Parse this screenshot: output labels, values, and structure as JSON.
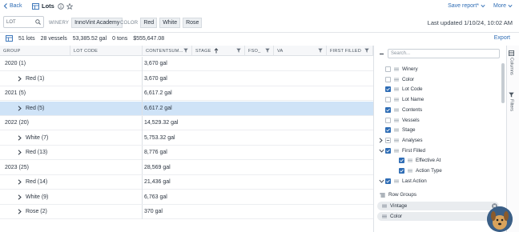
{
  "topbar": {
    "back_label": "Back",
    "title": "Lots",
    "save_report_label": "Save report*",
    "more_label": "More"
  },
  "filters": {
    "search_placeholder": "LOT",
    "winery_label": "WINERY",
    "winery_value": "InnoVint Academy",
    "color_label": "COLOR",
    "color_values": [
      "Red",
      "White",
      "Rose"
    ],
    "last_updated": "Last updated 1/10/24, 10:02 AM"
  },
  "summary": {
    "lots": "51 lots",
    "vessels": "28 vessels",
    "gallons": "53,385.52 gal",
    "tons": "0 tons",
    "value": "$555,647.08",
    "export_label": "Export"
  },
  "grid": {
    "headers": {
      "group": "GROUP",
      "lot_code": "LOT CODE",
      "contents": "CONTENTSUM...",
      "stage": "STAGE",
      "fso": "FSO_",
      "va": "VA",
      "first_filled": "FIRST FILLED"
    },
    "rows": [
      {
        "label": "2020 (1)",
        "contents": "3,670 gal",
        "level": 0,
        "expanded": true,
        "selected": false
      },
      {
        "label": "Red (1)",
        "contents": "3,670 gal",
        "level": 1,
        "expanded": false,
        "selected": false
      },
      {
        "label": "2021 (5)",
        "contents": "6,617.2 gal",
        "level": 0,
        "expanded": true,
        "selected": false
      },
      {
        "label": "Red (5)",
        "contents": "6,617.2 gal",
        "level": 1,
        "expanded": false,
        "selected": true
      },
      {
        "label": "2022 (20)",
        "contents": "14,529.32 gal",
        "level": 0,
        "expanded": true,
        "selected": false
      },
      {
        "label": "White (7)",
        "contents": "5,753.32 gal",
        "level": 1,
        "expanded": false,
        "selected": false
      },
      {
        "label": "Red (13)",
        "contents": "8,776 gal",
        "level": 1,
        "expanded": false,
        "selected": false
      },
      {
        "label": "2023 (25)",
        "contents": "28,569 gal",
        "level": 0,
        "expanded": true,
        "selected": false
      },
      {
        "label": "Red (14)",
        "contents": "21,436 gal",
        "level": 1,
        "expanded": false,
        "selected": false
      },
      {
        "label": "White (9)",
        "contents": "6,763 gal",
        "level": 1,
        "expanded": false,
        "selected": false
      },
      {
        "label": "Rose (2)",
        "contents": "370 gal",
        "level": 1,
        "expanded": false,
        "selected": false
      }
    ]
  },
  "panel": {
    "search_placeholder": "Search...",
    "columns": [
      {
        "label": "Winery",
        "checked": false,
        "indent": 0,
        "expander": false
      },
      {
        "label": "Color",
        "checked": false,
        "indent": 0,
        "expander": false
      },
      {
        "label": "Lot Code",
        "checked": true,
        "indent": 0,
        "expander": false
      },
      {
        "label": "Lot Name",
        "checked": false,
        "indent": 0,
        "expander": false
      },
      {
        "label": "Contents",
        "checked": true,
        "indent": 0,
        "expander": false
      },
      {
        "label": "Vessels",
        "checked": false,
        "indent": 0,
        "expander": false
      },
      {
        "label": "Stage",
        "checked": true,
        "indent": 0,
        "expander": false
      },
      {
        "label": "Analyses",
        "checked": "partial",
        "indent": 0,
        "expander": "collapsed"
      },
      {
        "label": "First Filled",
        "checked": true,
        "indent": 0,
        "expander": "expanded"
      },
      {
        "label": "Effective At",
        "checked": true,
        "indent": 1,
        "expander": false
      },
      {
        "label": "Action Type",
        "checked": true,
        "indent": 1,
        "expander": false
      },
      {
        "label": "Last Action",
        "checked": true,
        "indent": 0,
        "expander": "expanded"
      }
    ],
    "row_groups_title": "Row Groups",
    "row_groups": [
      "Vintage",
      "Color"
    ],
    "tabs": [
      "Columns",
      "Filters"
    ]
  },
  "colors": {
    "accent": "#2f6db5",
    "selected_row": "#cfe3f7",
    "chip_bg": "#eceff2"
  }
}
